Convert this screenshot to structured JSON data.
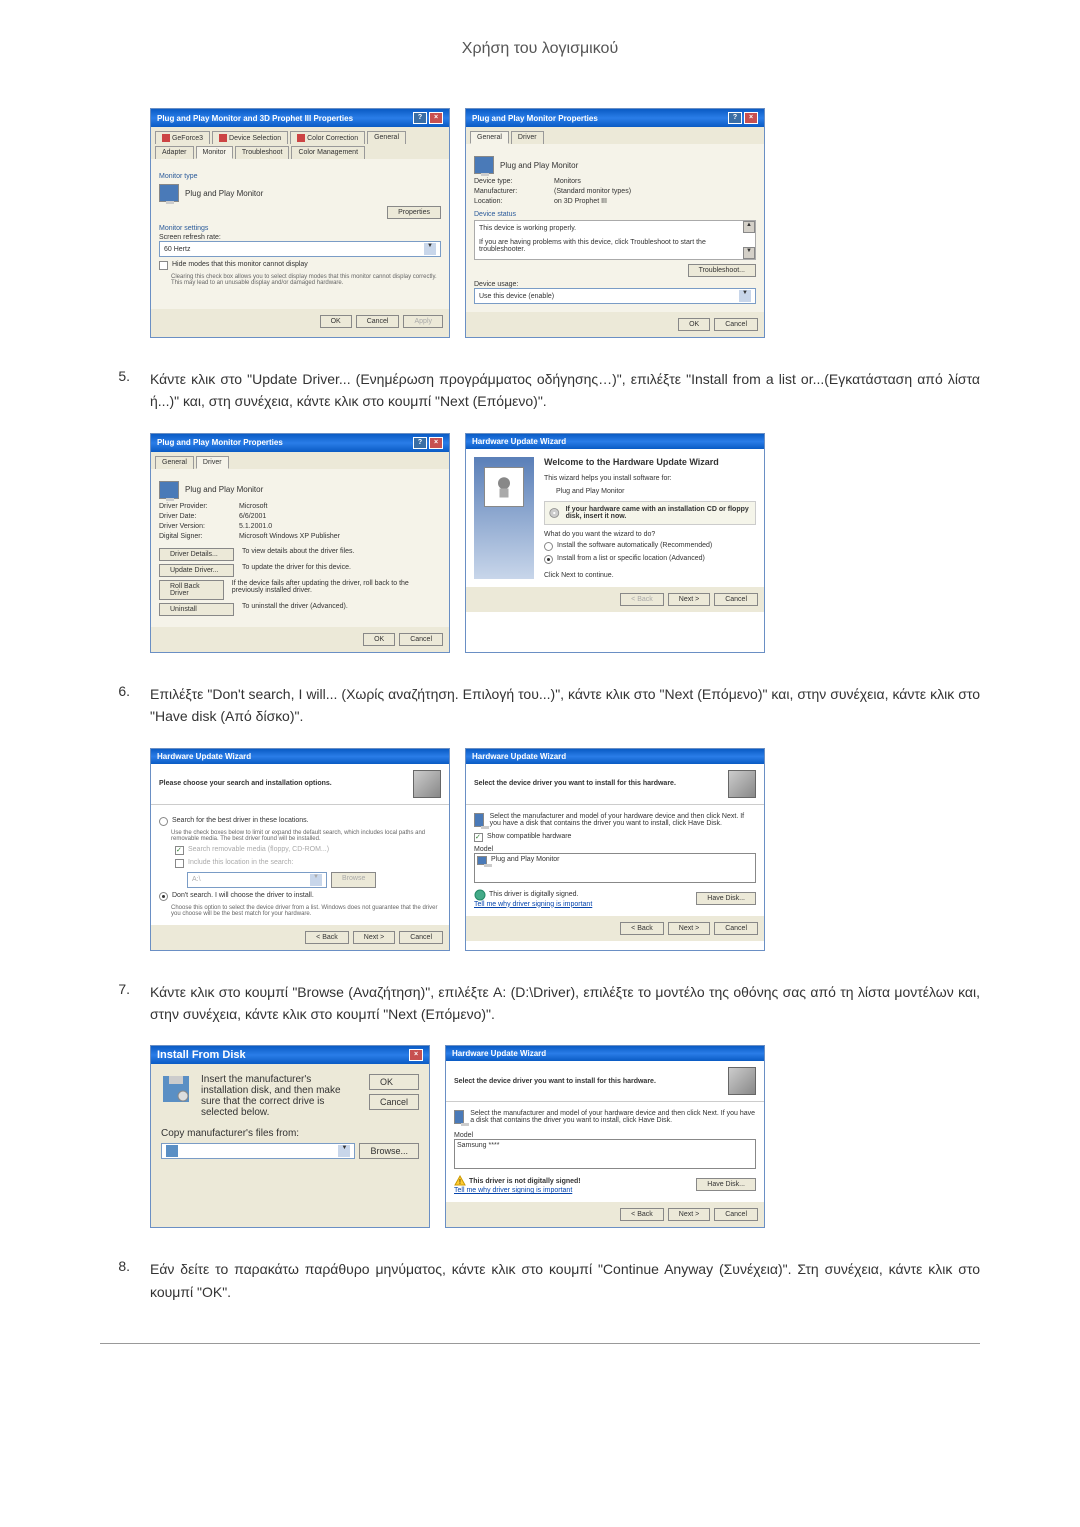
{
  "page_header": "Χρήση του λογισμικού",
  "steps": {
    "5": {
      "num": "5.",
      "text": "Κάντε κλικ στο \"Update Driver... (Ενημέρωση προγράμματος οδήγησης…)\", επιλέξτε \"Install from a list or...(Εγκατάσταση από λίστα ή...)\" και, στη συνέχεια, κάντε κλικ στο κουμπί \"Next (Επόμενο)\"."
    },
    "6": {
      "num": "6.",
      "text": "Επιλέξτε \"Don't search, I will... (Χωρίς αναζήτηση. Επιλογή του...)\", κάντε κλικ στο \"Next (Επόμενο)\" και, στην συνέχεια, κάντε κλικ στο \"Have disk (Από δίσκο)\"."
    },
    "7": {
      "num": "7.",
      "text": "Κάντε κλικ στο κουμπί \"Browse (Αναζήτηση)\", επιλέξτε A: (D:\\Driver), επιλέξτε το μοντέλο της οθόνης σας από τη λίστα μοντέλων και, στην συνέχεια, κάντε κλικ στο κουμπί \"Next (Επόμενο)\"."
    },
    "8": {
      "num": "8.",
      "text": "Εάν δείτε το παρακάτω παράθυρο μηνύματος, κάντε κλικ στο κουμπί \"Continue Anyway (Συνέχεια)\". Στη συνέχεια, κάντε κλικ στο κουμπί \"OK\"."
    }
  },
  "dialog1": {
    "title": "Plug and Play Monitor and 3D Prophet III Properties",
    "tabs": [
      "GeForce3",
      "Device Selection",
      "Color Correction",
      "General",
      "Adapter",
      "Monitor",
      "Troubleshoot",
      "Color Management"
    ],
    "monitor_type_label": "Monitor type",
    "monitor_name": "Plug and Play Monitor",
    "properties_btn": "Properties",
    "monitor_settings_label": "Monitor settings",
    "refresh_rate_label": "Screen refresh rate:",
    "refresh_rate": "60 Hertz",
    "hide_modes": "Hide modes that this monitor cannot display",
    "hide_desc": "Clearing this check box allows you to select display modes that this monitor cannot display correctly. This may lead to an unusable display and/or damaged hardware.",
    "ok": "OK",
    "cancel": "Cancel",
    "apply": "Apply"
  },
  "dialog2": {
    "title": "Plug and Play Monitor Properties",
    "tabs": [
      "General",
      "Driver"
    ],
    "monitor_name": "Plug and Play Monitor",
    "device_type_label": "Device type:",
    "device_type": "Monitors",
    "manufacturer_label": "Manufacturer:",
    "manufacturer": "(Standard monitor types)",
    "location_label": "Location:",
    "location": "on 3D Prophet III",
    "device_status_label": "Device status",
    "status_text": "This device is working properly.",
    "trouble_text": "If you are having problems with this device, click Troubleshoot to start the troubleshooter.",
    "troubleshoot_btn": "Troubleshoot...",
    "device_usage_label": "Device usage:",
    "device_usage": "Use this device (enable)",
    "ok": "OK",
    "cancel": "Cancel"
  },
  "dialog3": {
    "title": "Plug and Play Monitor Properties",
    "tabs": [
      "General",
      "Driver"
    ],
    "monitor_name": "Plug and Play Monitor",
    "provider_label": "Driver Provider:",
    "provider": "Microsoft",
    "date_label": "Driver Date:",
    "date": "6/6/2001",
    "version_label": "Driver Version:",
    "version": "5.1.2001.0",
    "signer_label": "Digital Signer:",
    "signer": "Microsoft Windows XP Publisher",
    "details_btn": "Driver Details...",
    "details_desc": "To view details about the driver files.",
    "update_btn": "Update Driver...",
    "update_desc": "To update the driver for this device.",
    "rollback_btn": "Roll Back Driver",
    "rollback_desc": "If the device fails after updating the driver, roll back to the previously installed driver.",
    "uninstall_btn": "Uninstall",
    "uninstall_desc": "To uninstall the driver (Advanced).",
    "ok": "OK",
    "cancel": "Cancel"
  },
  "dialog4": {
    "title": "Hardware Update Wizard",
    "welcome": "Welcome to the Hardware Update Wizard",
    "help_text": "This wizard helps you install software for:",
    "device": "Plug and Play Monitor",
    "cd_text": "If your hardware came with an installation CD or floppy disk, insert it now.",
    "what_do": "What do you want the wizard to do?",
    "opt1": "Install the software automatically (Recommended)",
    "opt2": "Install from a list or specific location (Advanced)",
    "click_next": "Click Next to continue.",
    "back": "< Back",
    "next": "Next >",
    "cancel": "Cancel"
  },
  "dialog5": {
    "title": "Hardware Update Wizard",
    "header": "Please choose your search and installation options.",
    "opt1": "Search for the best driver in these locations.",
    "opt1_desc": "Use the check boxes below to limit or expand the default search, which includes local paths and removable media. The best driver found will be installed.",
    "check1": "Search removable media (floppy, CD-ROM...)",
    "check2": "Include this location in the search:",
    "path": "A:\\",
    "browse": "Browse",
    "opt2": "Don't search. I will choose the driver to install.",
    "opt2_desc": "Choose this option to select the device driver from a list. Windows does not guarantee that the driver you choose will be the best match for your hardware.",
    "back": "< Back",
    "next": "Next >",
    "cancel": "Cancel"
  },
  "dialog6": {
    "title": "Hardware Update Wizard",
    "header": "Select the device driver you want to install for this hardware.",
    "desc": "Select the manufacturer and model of your hardware device and then click Next. If you have a disk that contains the driver you want to install, click Have Disk.",
    "show_compat": "Show compatible hardware",
    "model_label": "Model",
    "model": "Plug and Play Monitor",
    "signed_text": "This driver is digitally signed.",
    "tell_me": "Tell me why driver signing is important",
    "have_disk": "Have Disk...",
    "back": "< Back",
    "next": "Next >",
    "cancel": "Cancel"
  },
  "dialog7": {
    "title": "Install From Disk",
    "desc": "Insert the manufacturer's installation disk, and then make sure that the correct drive is selected below.",
    "ok": "OK",
    "cancel": "Cancel",
    "copy_label": "Copy manufacturer's files from:",
    "browse": "Browse..."
  },
  "dialog8": {
    "title": "Hardware Update Wizard",
    "header": "Select the device driver you want to install for this hardware.",
    "desc": "Select the manufacturer and model of your hardware device and then click Next. If you have a disk that contains the driver you want to install, click Have Disk.",
    "model_label": "Model",
    "model": "Samsung ****",
    "not_signed": "This driver is not digitally signed!",
    "tell_me": "Tell me why driver signing is important",
    "have_disk": "Have Disk...",
    "back": "< Back",
    "next": "Next >",
    "cancel": "Cancel"
  }
}
